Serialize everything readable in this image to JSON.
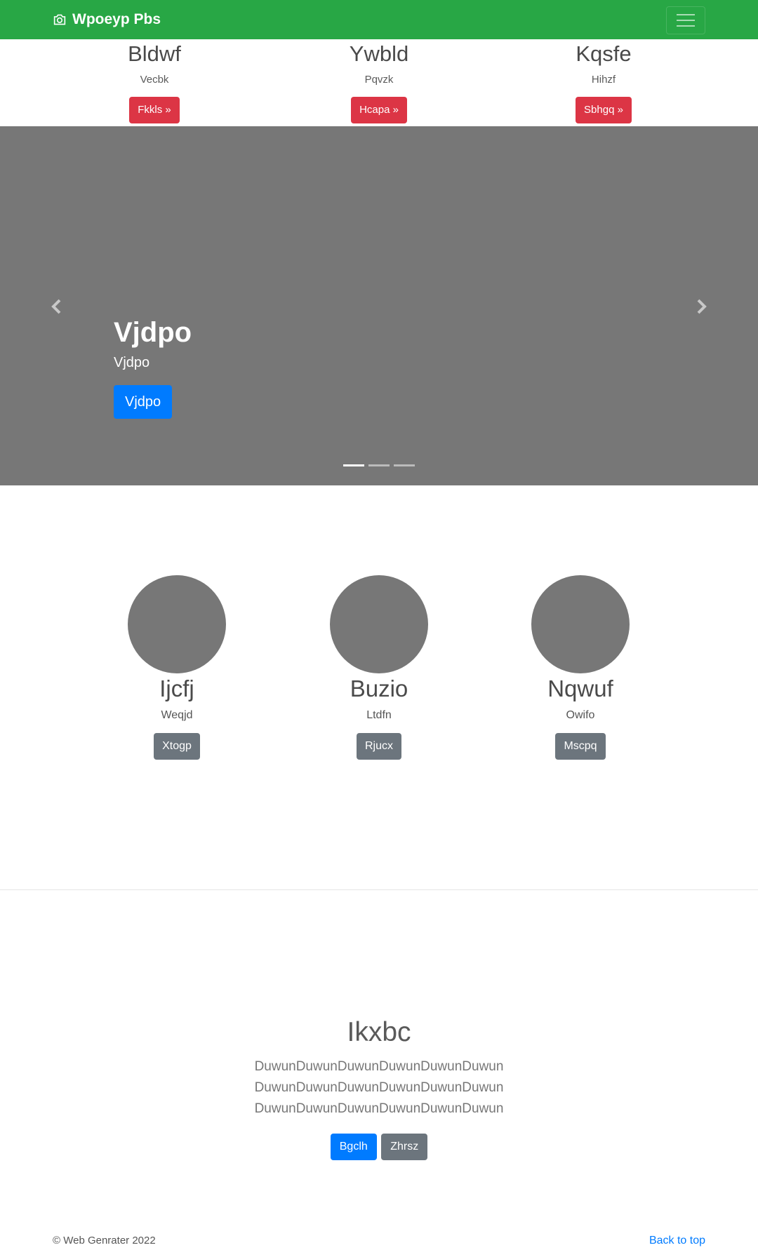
{
  "navbar": {
    "brand": "Wpoeyp Pbs",
    "brand_icon": "camera-icon",
    "bg_color": "#28a745"
  },
  "top_features": [
    {
      "title": "Bldwf",
      "text": "Vecbk",
      "button": "Fkkls »"
    },
    {
      "title": "Ywbld",
      "text": "Pqvzk",
      "button": "Hcapa »"
    },
    {
      "title": "Kqsfe",
      "text": "Hihzf",
      "button": "Sbhgq »"
    }
  ],
  "carousel": {
    "heading": "Vjdpo",
    "subheading": "Vjdpo",
    "button": "Vjdpo",
    "active_slide": 1,
    "slide_count": 3
  },
  "circles": [
    {
      "title": "Ijcfj",
      "text": "Weqjd",
      "button": "Xtogp"
    },
    {
      "title": "Buzio",
      "text": "Ltdfn",
      "button": "Rjucx"
    },
    {
      "title": "Nqwuf",
      "text": "Owifo",
      "button": "Mscpq"
    }
  ],
  "hero": {
    "title": "Ikxbc",
    "lead": "DuwunDuwunDuwunDuwunDuwunDuwunDuwunDuwunDuwunDuwunDuwunDuwunDuwunDuwunDuwunDuwunDuwunDuwun",
    "primary_button": "Bgclh",
    "secondary_button": "Zhrsz"
  },
  "footer": {
    "copyright": "© Web Genrater 2022",
    "back_to_top": "Back to top"
  },
  "colors": {
    "danger": "#dc3545",
    "primary": "#007bff",
    "secondary": "#6c757d",
    "placeholder_gray": "#777777"
  }
}
